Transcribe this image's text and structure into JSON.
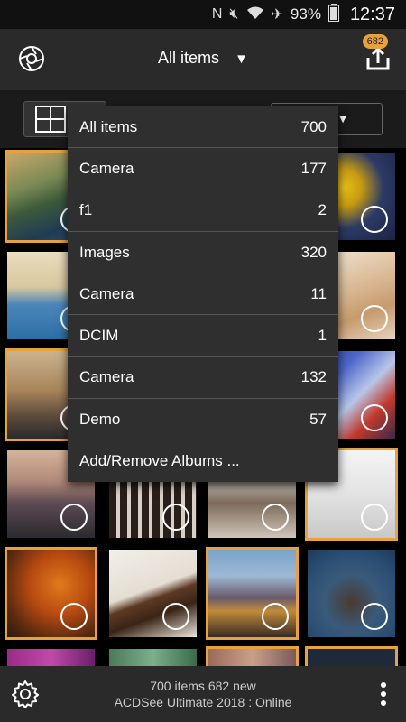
{
  "status_bar": {
    "battery": "93%",
    "time": "12:37",
    "icons": [
      "nfc-icon",
      "mute-icon",
      "wifi-icon",
      "airplane-icon",
      "battery-icon"
    ]
  },
  "app_bar": {
    "title": "All items",
    "upload_badge": "682"
  },
  "menu": {
    "items": [
      {
        "label": "All items",
        "count": "700"
      },
      {
        "label": "Camera",
        "count": "177"
      },
      {
        "label": "f1",
        "count": "2"
      },
      {
        "label": "Images",
        "count": "320"
      },
      {
        "label": "Camera",
        "count": "11"
      },
      {
        "label": "DCIM",
        "count": "1"
      },
      {
        "label": "Camera",
        "count": "132"
      },
      {
        "label": "Demo",
        "count": "57"
      }
    ],
    "add_remove": "Add/Remove Albums ..."
  },
  "bottom_bar": {
    "items_line": "700 items  682 new",
    "product_line": "ACDSee Ultimate 2018 : Online"
  },
  "colors": {
    "accent": "#e6a23c",
    "bar_bg": "#2a2a2a",
    "menu_bg": "#2f2f2f"
  }
}
